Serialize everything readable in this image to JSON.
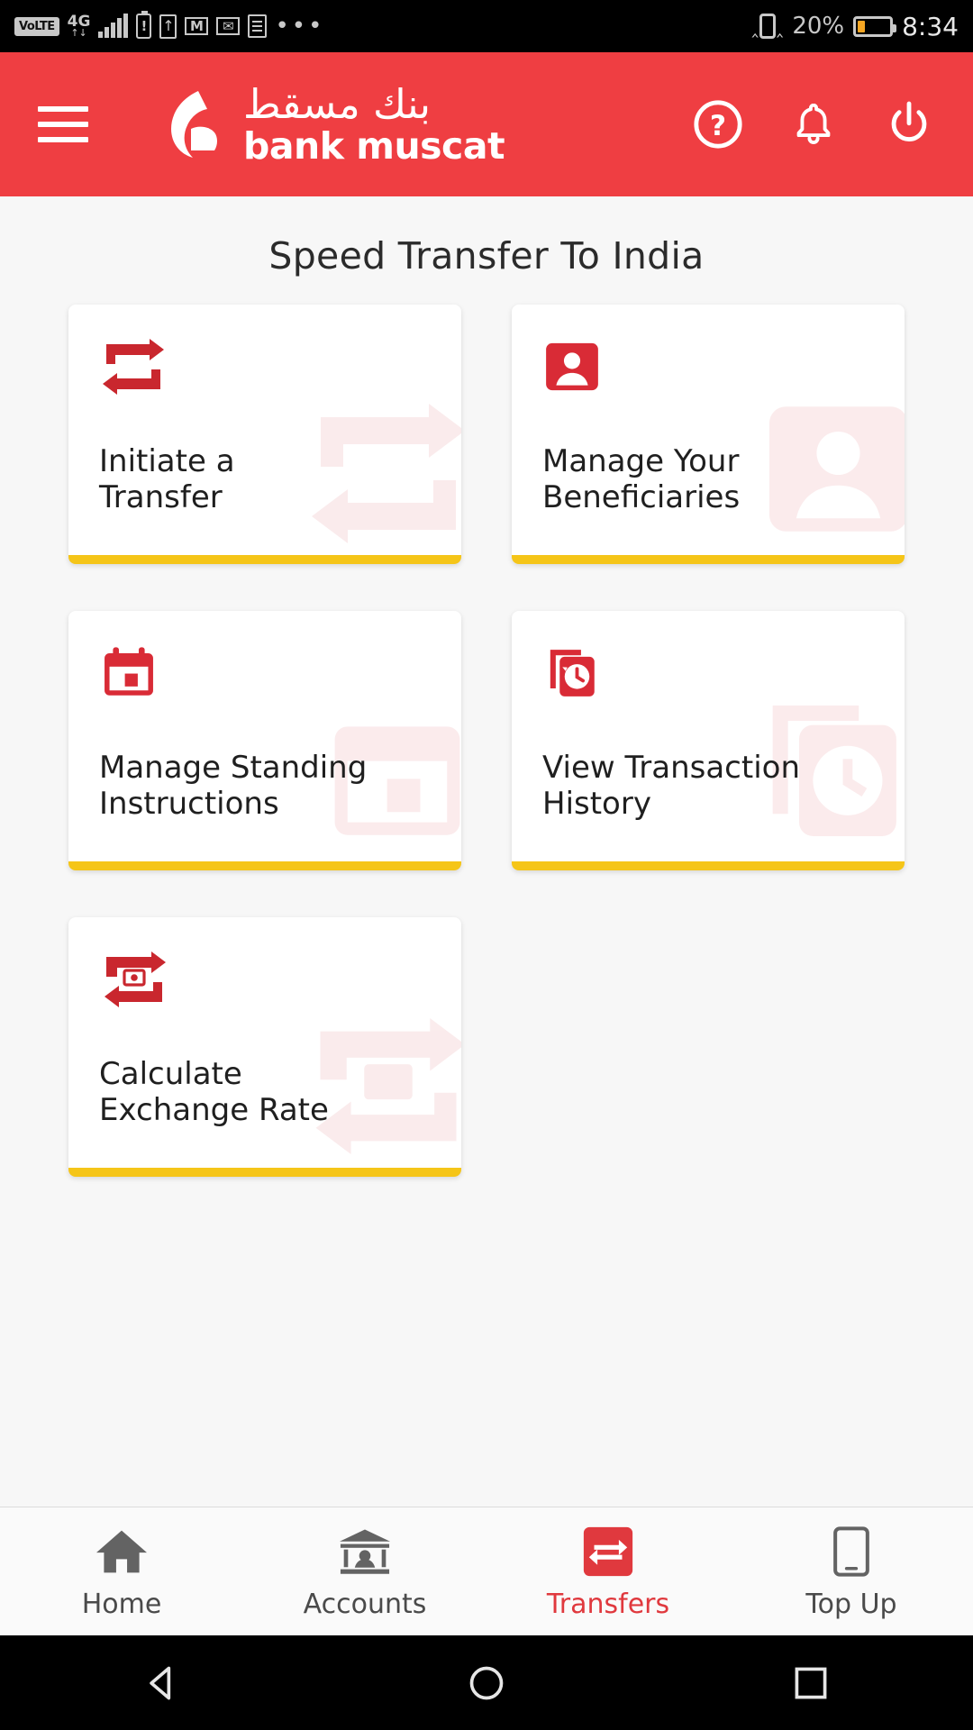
{
  "status_bar": {
    "volte_label": "VoLTE",
    "network_type": "4G",
    "signal_bars": 5,
    "icons": [
      "volte-icon",
      "4g-signal-icon",
      "signal-bars-icon",
      "battery-warning-icon",
      "upload-icon",
      "gmail-icon",
      "email-sync-icon",
      "document-icon",
      "more-icons"
    ],
    "overflow_dots": "•••",
    "vibrate_icon": "vibrate-icon",
    "battery_percent": "20%",
    "battery_level": 20,
    "time": "8:34"
  },
  "header": {
    "menu_icon": "hamburger-menu-icon",
    "brand_arabic": "بنك مسقط",
    "brand_english": "bank muscat",
    "actions": [
      {
        "name": "help-icon",
        "label": "Help"
      },
      {
        "name": "notifications-bell-icon",
        "label": "Notifications"
      },
      {
        "name": "power-logout-icon",
        "label": "Logout"
      }
    ],
    "background_color": "#ef3e42"
  },
  "page": {
    "title": "Speed Transfer To India"
  },
  "cards": [
    {
      "label": "Initiate a\nTransfer",
      "icon": "transfer-arrows-icon",
      "accent": "#f5c518"
    },
    {
      "label": "Manage Your\nBeneficiaries",
      "icon": "beneficiary-person-icon",
      "accent": "#f5c518"
    },
    {
      "label": "Manage Standing\nInstructions",
      "icon": "calendar-icon",
      "accent": "#f5c518"
    },
    {
      "label": "View Transaction\nHistory",
      "icon": "history-clock-icon",
      "accent": "#f5c518"
    },
    {
      "label": "Calculate\nExchange Rate",
      "icon": "exchange-rate-icon",
      "accent": "#f5c518"
    }
  ],
  "bottom_nav": {
    "items": [
      {
        "label": "Home",
        "icon": "home-icon",
        "active": false
      },
      {
        "label": "Accounts",
        "icon": "accounts-bank-icon",
        "active": false
      },
      {
        "label": "Transfers",
        "icon": "transfers-icon",
        "active": true
      },
      {
        "label": "Top Up",
        "icon": "top-up-phone-icon",
        "active": false
      }
    ],
    "active_color": "#e0393e"
  },
  "android_nav": {
    "buttons": [
      {
        "name": "back-triangle-icon",
        "label": "Back"
      },
      {
        "name": "home-circle-icon",
        "label": "Home"
      },
      {
        "name": "recents-square-icon",
        "label": "Recents"
      }
    ]
  },
  "colors": {
    "brand_red": "#ef3e42",
    "icon_red": "#c9272e",
    "accent_yellow": "#f5c518",
    "page_background": "#f7f7f7"
  }
}
